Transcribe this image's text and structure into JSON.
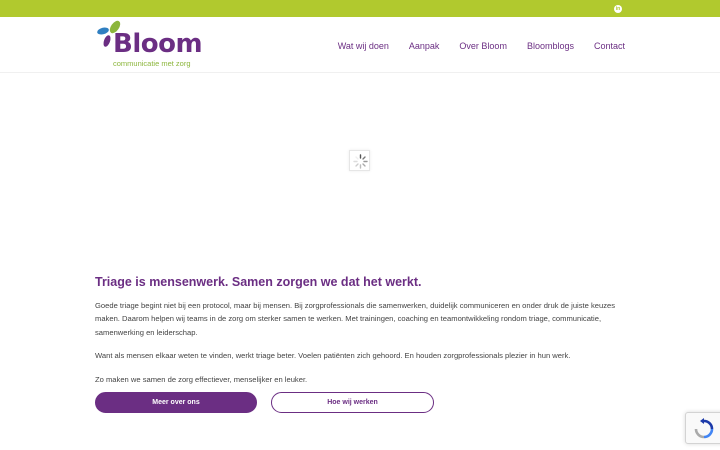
{
  "topbar": {
    "linkedin_icon": "linkedin-icon",
    "linkedin_label": "in",
    "color": "#b1c92e"
  },
  "header": {
    "logo": {
      "word": "Bloom",
      "tagline": "communicatie met zorg"
    },
    "nav": [
      {
        "label": "Wat wij doen"
      },
      {
        "label": "Aanpak"
      },
      {
        "label": "Over Bloom"
      },
      {
        "label": "Bloomblogs"
      },
      {
        "label": "Contact"
      }
    ]
  },
  "main": {
    "loader_icon": "loading-icon",
    "headline": "Triage is mensenwerk. Samen zorgen we dat het werkt.",
    "paragraphs": [
      "Goede triage begint niet bij een protocol, maar bij mensen. Bij zorgprofessionals die samenwerken, duidelijk communiceren en onder druk de juiste keuzes maken. Daarom helpen wij teams in de zorg om sterker samen te werken. Met trainingen, coaching en teamontwikkeling rondom triage, communicatie, samenwerking en leiderschap.",
      "Want als mensen elkaar weten te vinden, werkt triage beter. Voelen patiënten zich gehoord. En houden zorgprofessionals plezier in hun werk.",
      "Zo maken we samen de zorg effectiever, menselijker en leuker."
    ],
    "buttons": {
      "primary": "Meer over ons",
      "secondary": "Hoe wij werken"
    }
  },
  "recaptcha": {
    "icon": "recaptcha-icon"
  },
  "colors": {
    "brand_purple": "#6b2e83",
    "brand_green": "#b1c92e",
    "leaf_blue": "#2f7fc1"
  }
}
